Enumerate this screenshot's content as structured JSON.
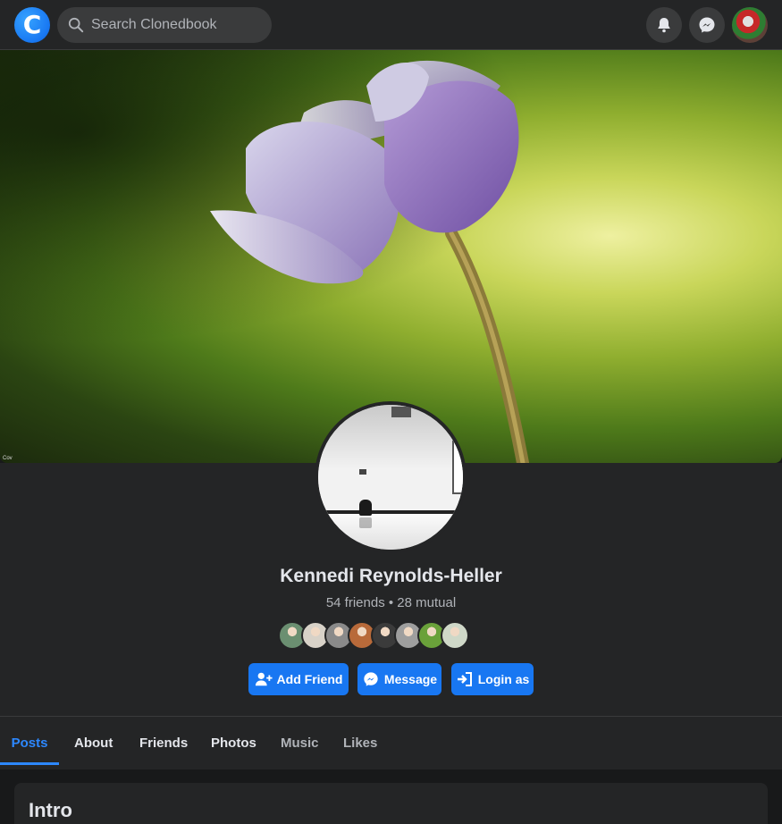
{
  "header": {
    "logo_letter": "C",
    "search_placeholder": "Search Clonedbook",
    "icons": [
      "bell-icon",
      "messenger-icon",
      "user-avatar"
    ]
  },
  "cover": {
    "corner_text": "Cov"
  },
  "profile": {
    "name": "Kennedi Reynolds-Heller",
    "friends_summary": "54 friends • 28 mutual",
    "friend_avatar_colors": [
      "#6b8f71",
      "#d8d2c8",
      "#8a8a8a",
      "#b86a3a",
      "#3b3b3b",
      "#9e9e9e",
      "#6aa13a",
      "#cfd8c8"
    ]
  },
  "actions": {
    "add_friend": "Add Friend",
    "message": "Message",
    "login_as": "Login as"
  },
  "tabs": [
    {
      "label": "Posts",
      "active": true
    },
    {
      "label": "About",
      "active": false
    },
    {
      "label": "Friends",
      "active": false
    },
    {
      "label": "Photos",
      "active": false
    },
    {
      "label": "Music",
      "active": false
    },
    {
      "label": "Likes",
      "active": false
    }
  ],
  "intro": {
    "title": "Intro"
  },
  "colors": {
    "accent": "#1877f2",
    "active_tab": "#2d88ff",
    "background": "#18191a",
    "panel": "#242526"
  }
}
